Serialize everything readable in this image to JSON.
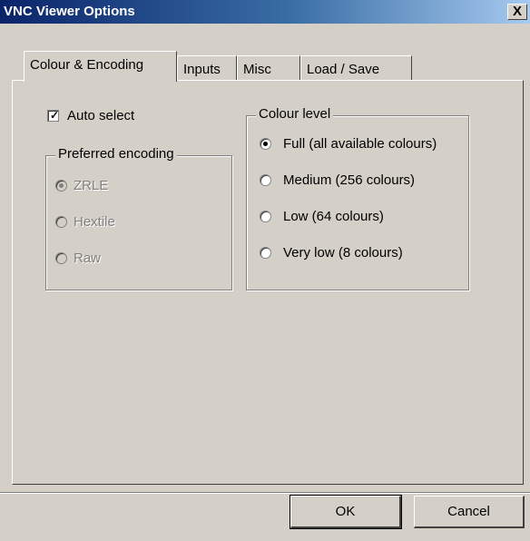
{
  "window": {
    "title": "VNC Viewer Options",
    "close_glyph": "X"
  },
  "tabs": [
    {
      "label": "Colour & Encoding",
      "active": true
    },
    {
      "label": "Inputs",
      "active": false
    },
    {
      "label": "Misc",
      "active": false
    },
    {
      "label": "Load / Save",
      "active": false
    }
  ],
  "auto_select": {
    "label": "Auto select",
    "checked": true
  },
  "preferred_encoding": {
    "legend": "Preferred encoding",
    "enabled": false,
    "options": [
      {
        "label": "ZRLE",
        "selected": true
      },
      {
        "label": "Hextile",
        "selected": false
      },
      {
        "label": "Raw",
        "selected": false
      }
    ]
  },
  "colour_level": {
    "legend": "Colour level",
    "options": [
      {
        "label": "Full (all available colours)",
        "selected": true
      },
      {
        "label": "Medium (256 colours)",
        "selected": false
      },
      {
        "label": "Low (64 colours)",
        "selected": false
      },
      {
        "label": "Very low (8 colours)",
        "selected": false
      }
    ]
  },
  "buttons": {
    "ok": "OK",
    "cancel": "Cancel"
  },
  "colors": {
    "titlebar_start": "#0a246a",
    "titlebar_end": "#a6caf0",
    "face": "#d4d0c8"
  }
}
